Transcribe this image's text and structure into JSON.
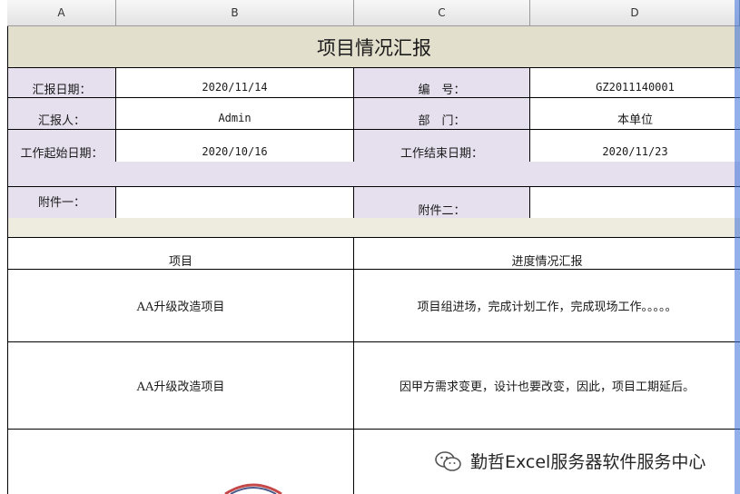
{
  "columns": [
    "A",
    "B",
    "C",
    "D"
  ],
  "report": {
    "title": "项目情况汇报",
    "fields": {
      "report_date_label": "汇报日期：",
      "report_date": "2020/11/14",
      "number_label": "编　号：",
      "number": "GZ2011140001",
      "reporter_label": "汇报人：",
      "reporter": "Admin",
      "department_label": "部　门：",
      "department": "本单位",
      "start_date_label": "工作起始日期：",
      "start_date": "2020/10/16",
      "end_date_label": "工作结束日期：",
      "end_date": "2020/11/23",
      "attachment1_label": "附件一：",
      "attachment2_label": "附件二："
    },
    "table": {
      "headers": [
        "项目",
        "进度情况汇报"
      ],
      "rows": [
        {
          "project": "AA升级改造项目",
          "progress": "项目组进场，完成计划工作，完成现场工作。。。。。"
        },
        {
          "project": "AA升级改造项目",
          "progress": "因甲方需求变更，设计也要改变，因此，项目工期延后。"
        }
      ]
    }
  },
  "watermark": {
    "text": "勤哲Excel服务器软件服务中心",
    "icon": "wechat-icon"
  },
  "colors": {
    "title_bg": "#e3dfcd",
    "label_bg": "#e6e0ee",
    "separator_bg": "#eeebdf",
    "header_bg": "#e9e9e9"
  }
}
